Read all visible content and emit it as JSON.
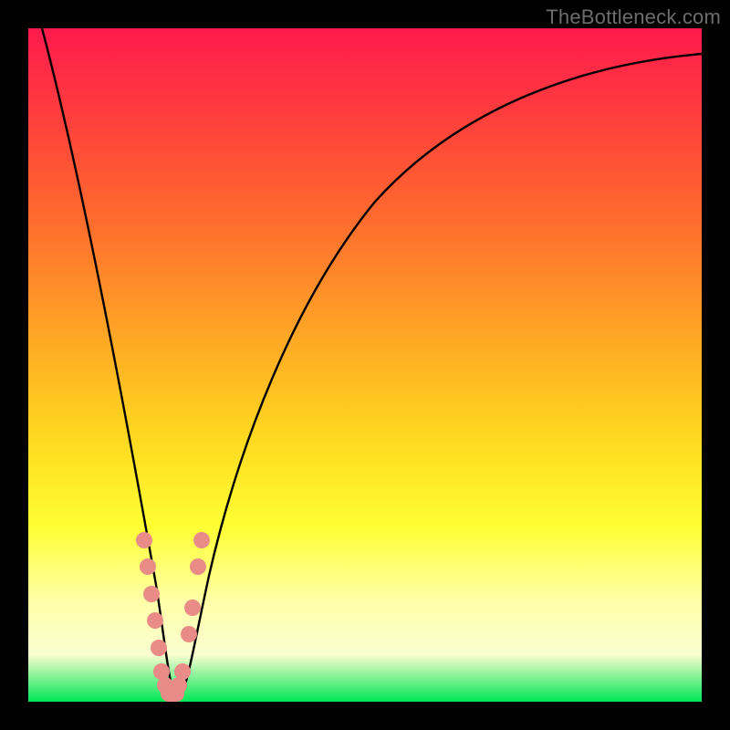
{
  "watermark": "TheBottleneck.com",
  "chart_data": {
    "type": "line",
    "title": "",
    "xlabel": "",
    "ylabel": "",
    "xlim": [
      0,
      100
    ],
    "ylim": [
      0,
      100
    ],
    "grid": false,
    "legend": false,
    "note": "Bottleneck-percentage-style curve. X axis roughly = relative component score, Y axis roughly = bottleneck %. Values estimated from pixels (no axis ticks rendered).",
    "series": [
      {
        "name": "bottleneck-curve",
        "x": [
          2,
          5,
          8,
          11,
          14,
          16,
          18,
          19.5,
          20.8,
          22,
          23.2,
          25,
          27,
          30,
          34,
          40,
          48,
          58,
          70,
          85,
          100
        ],
        "y": [
          100,
          88,
          75,
          60,
          44,
          30,
          16,
          6,
          1,
          0.5,
          1,
          6,
          16,
          32,
          47,
          60,
          72,
          81,
          88,
          92.5,
          95
        ],
        "color": "#000000"
      }
    ],
    "markers": {
      "name": "sample-dots",
      "color": "#e98b86",
      "radius_approx": 1.2,
      "points_xy": [
        [
          17.2,
          24
        ],
        [
          17.8,
          20
        ],
        [
          18.3,
          16
        ],
        [
          18.8,
          12
        ],
        [
          19.4,
          8
        ],
        [
          19.8,
          4.5
        ],
        [
          20.3,
          2.5
        ],
        [
          20.8,
          1.2
        ],
        [
          21.4,
          1.0
        ],
        [
          21.9,
          1.2
        ],
        [
          22.4,
          2.5
        ],
        [
          22.9,
          4.5
        ],
        [
          23.8,
          10
        ],
        [
          24.4,
          14
        ],
        [
          25.2,
          20
        ],
        [
          25.8,
          24
        ]
      ]
    },
    "background_gradient": {
      "top": "#ff1a4d",
      "mid": "#ffff33",
      "bottom": "#00e756"
    }
  }
}
